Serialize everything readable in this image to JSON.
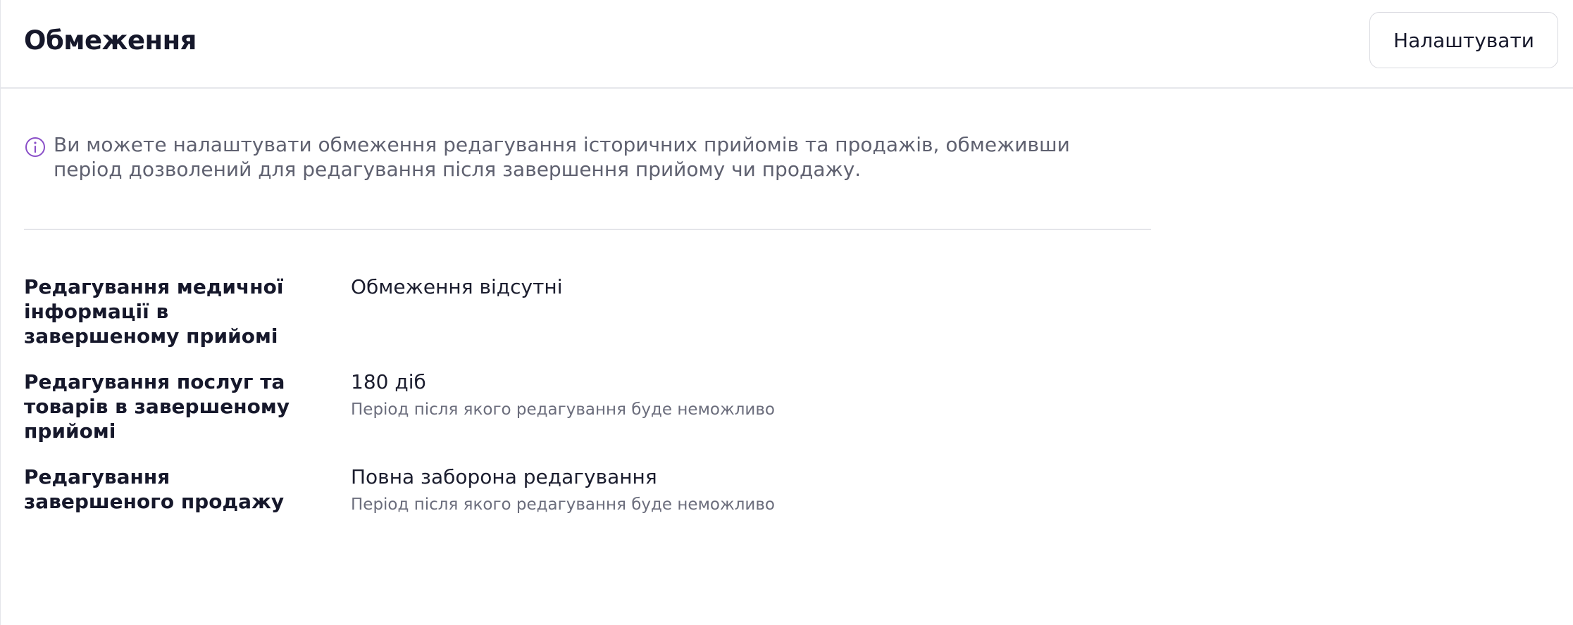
{
  "header": {
    "title": "Обмеження",
    "configure_label": "Налаштувати"
  },
  "info": {
    "icon": "info-icon",
    "text": "Ви можете налаштувати обмеження редагування історичних прийомів та продажів, обмеживши період дозволений для редагування після завершення прийому чи продажу."
  },
  "settings": [
    {
      "label": "Редагування медичної інформації в завершеному прийомі",
      "value": "Обмеження відсутні",
      "hint": ""
    },
    {
      "label": "Редагування послуг та товарів в завершеному прийомі",
      "value": "180 діб",
      "hint": "Період після якого редагування буде неможливо"
    },
    {
      "label": "Редагування завершеного продажу",
      "value": "Повна заборона редагування",
      "hint": "Період після якого редагування буде неможливо"
    }
  ],
  "colors": {
    "accent": "#8a4fc8",
    "text": "#16182b",
    "muted": "#5f6170",
    "border": "#e4e5ea"
  }
}
